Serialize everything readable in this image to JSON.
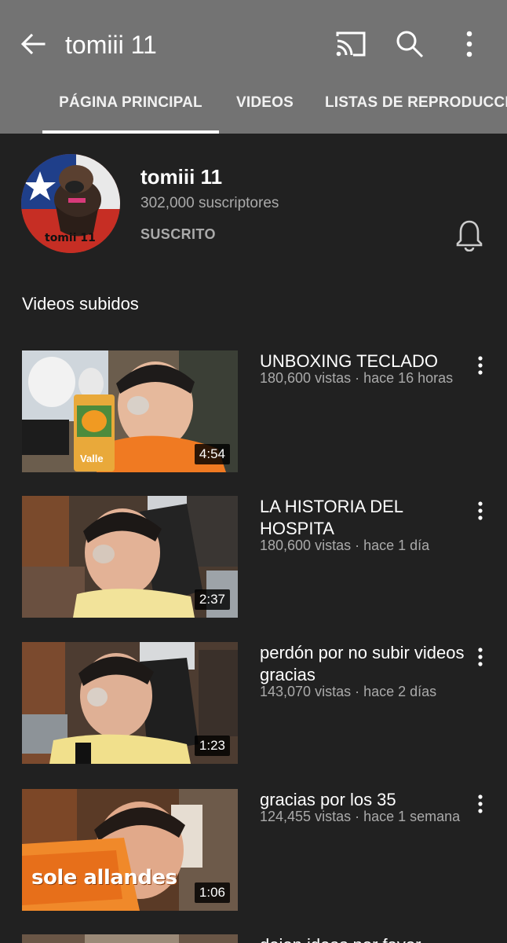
{
  "header": {
    "title": "tomiii 11",
    "icons": [
      "back-arrow-icon",
      "cast-icon",
      "search-icon",
      "more-vert-icon"
    ]
  },
  "tabs": [
    {
      "label": "PÁGINA PRINCIPAL",
      "selected": true
    },
    {
      "label": "VIDEOS",
      "selected": false
    },
    {
      "label": "LISTAS DE REPRODUCCIO",
      "selected": false
    }
  ],
  "channel": {
    "name": "tomiii 11",
    "subscribers": "302,000 suscriptores",
    "subscribe_state": "SUSCRITO",
    "avatar_text": "tomii 11",
    "bell_icon": "notification-bell-icon"
  },
  "section_title": "Videos subidos",
  "videos": [
    {
      "title": "UNBOXING TECLADO",
      "views": "180,600 vistas",
      "age": "hace 16 horas",
      "duration": "4:54",
      "thumb_text": "Valle"
    },
    {
      "title": "LA HISTORIA DEL HOSPITA",
      "views": "180,600 vistas",
      "age": "hace 1 día",
      "duration": "2:37"
    },
    {
      "title": "perdón por no subir videos gracias",
      "views": "143,070 vistas",
      "age": "hace 2 días",
      "duration": "1:23"
    },
    {
      "title": "gracias por los 35",
      "views": "124,455 vistas",
      "age": "hace 1 semana",
      "duration": "1:06",
      "thumb_text": "sole allandes"
    },
    {
      "title": "dejen ideas por favor"
    }
  ],
  "colors": {
    "app_bar": "#737373",
    "background": "#212121",
    "secondary_text": "#aaaaaa"
  }
}
